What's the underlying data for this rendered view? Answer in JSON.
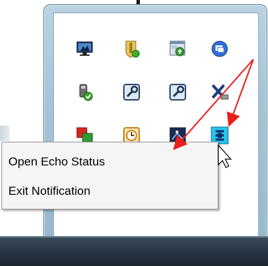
{
  "context_menu": {
    "items": [
      {
        "label": "Open Echo Status"
      },
      {
        "label": "Exit Notification"
      }
    ]
  },
  "tray_icons": [
    {
      "name": "network-monitor-icon"
    },
    {
      "name": "shield-status-icon"
    },
    {
      "name": "window-update-icon"
    },
    {
      "name": "blue-circle-app-icon"
    },
    {
      "name": "usb-device-ok-icon"
    },
    {
      "name": "wrench-tool-icon"
    },
    {
      "name": "wrench-tool-icon-2"
    },
    {
      "name": "safely-remove-usb-icon"
    },
    {
      "name": "red-green-squares-icon"
    },
    {
      "name": "clock-icon"
    },
    {
      "name": "dark-square-app-icon"
    },
    {
      "name": "echo-app-icon"
    }
  ],
  "colors": {
    "arrow": "#e8201c",
    "frame": "#a6c4d8",
    "taskbar": "#243240"
  }
}
